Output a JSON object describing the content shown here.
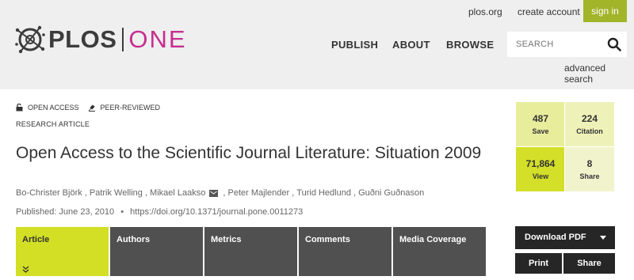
{
  "header": {
    "brand_left": "PLOS",
    "brand_right": "ONE",
    "top_links": {
      "plos_org": "plos.org",
      "create_account": "create account",
      "sign_in": "sign in"
    },
    "nav": {
      "publish": "PUBLISH",
      "about": "ABOUT",
      "browse": "BROWSE"
    },
    "search": {
      "placeholder": "SEARCH",
      "value": ""
    },
    "advanced_search": "advanced search"
  },
  "article": {
    "badges": {
      "open_access": "OPEN ACCESS",
      "peer_reviewed": "PEER-REVIEWED"
    },
    "type": "RESEARCH ARTICLE",
    "title": "Open Access to the Scientific Journal Literature: Situation 2009",
    "authors": [
      "Bo-Christer Björk",
      "Patrik Welling",
      "Mikael Laakso",
      "Peter Majlender",
      "Turid Hedlund",
      "Guðni Guðnason"
    ],
    "published": "Published: June 23, 2010",
    "separator": "•",
    "doi": "https://doi.org/10.1371/journal.pone.0011273"
  },
  "tabs": [
    "Article",
    "Authors",
    "Metrics",
    "Comments",
    "Media Coverage"
  ],
  "metrics": {
    "save": {
      "value": "487",
      "label": "Save"
    },
    "citation": {
      "value": "224",
      "label": "Citation"
    },
    "view": {
      "value": "71,864",
      "label": "View"
    },
    "share": {
      "value": "8",
      "label": "Share"
    }
  },
  "actions": {
    "download_pdf": "Download PDF",
    "print": "Print",
    "share": "Share"
  },
  "colors": {
    "accent_green": "#d2df24",
    "brand_magenta": "#c62e8f",
    "dark_button": "#262626",
    "tab_gray": "#505050",
    "signin_green": "#a2b42a"
  }
}
